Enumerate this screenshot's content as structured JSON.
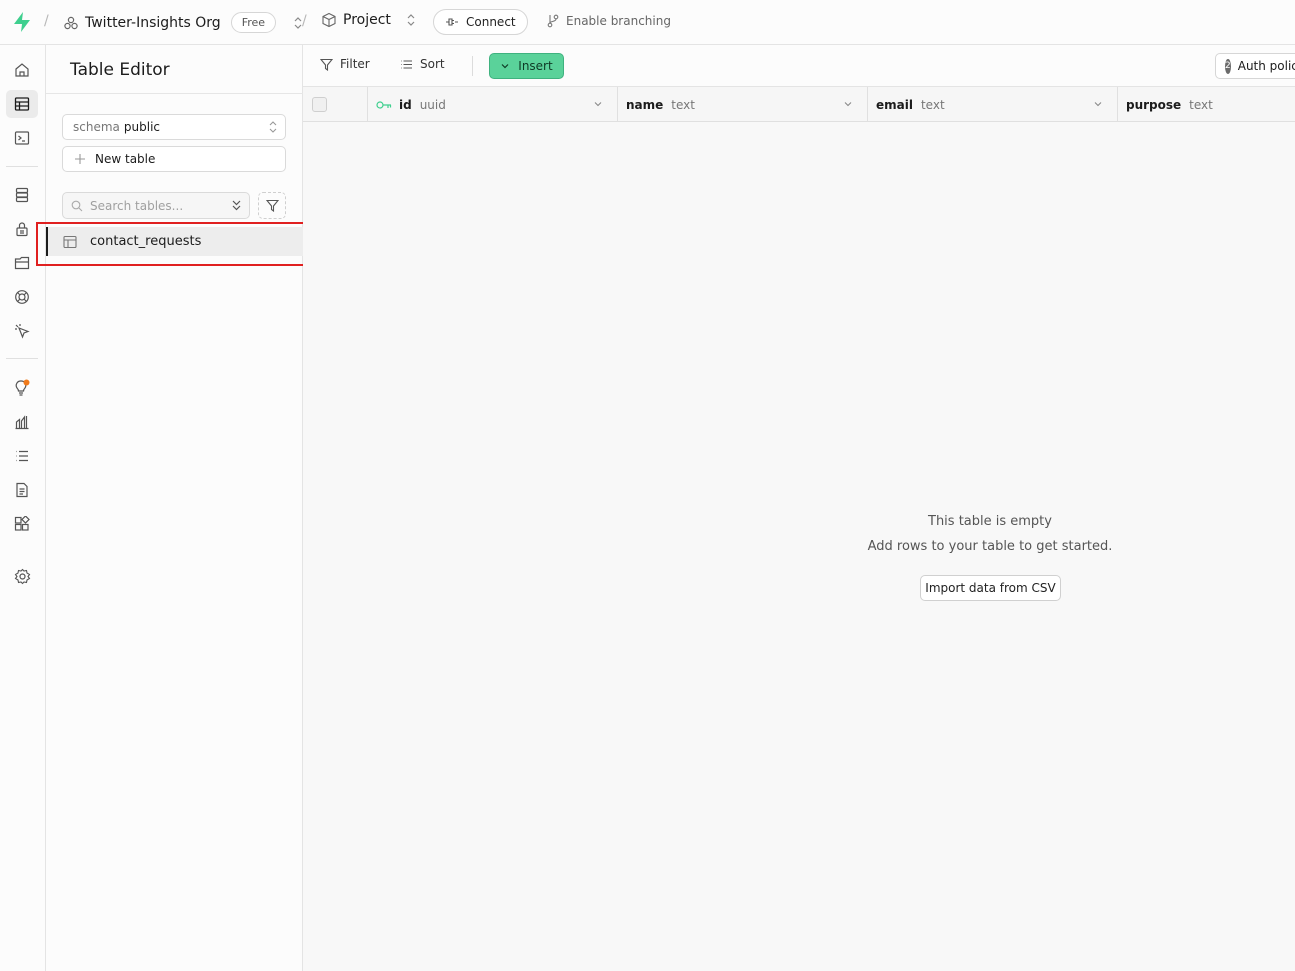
{
  "topbar": {
    "org_name": "Twitter-Insights Org",
    "plan_badge": "Free",
    "project_name": "Project",
    "connect_label": "Connect",
    "branching_label": "Enable branching"
  },
  "sidebar": {
    "title": "Table Editor",
    "schema_prefix": "schema",
    "schema_value": "public",
    "new_table_label": "New table",
    "search_placeholder": "Search tables...",
    "tables": [
      {
        "name": "contact_requests",
        "selected": true
      }
    ]
  },
  "toolbar": {
    "filter_label": "Filter",
    "sort_label": "Sort",
    "insert_label": "Insert",
    "auth_count": "2",
    "auth_label": "Auth policies"
  },
  "grid": {
    "columns": [
      {
        "name": "id",
        "type": "uuid",
        "primary_key": true
      },
      {
        "name": "name",
        "type": "text"
      },
      {
        "name": "email",
        "type": "text"
      },
      {
        "name": "purpose",
        "type": "text"
      }
    ]
  },
  "empty_state": {
    "title": "This table is empty",
    "subtitle": "Add rows to your table to get started.",
    "import_label": "Import data from CSV"
  },
  "colors": {
    "accent": "#5ad29a",
    "brand_logo": "#3ecf8e",
    "highlight": "#e02020",
    "notification_dot": "#f07a1a"
  }
}
